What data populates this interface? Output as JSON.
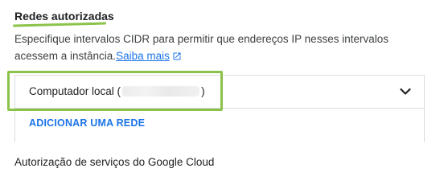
{
  "authorized_networks": {
    "title": "Redes autorizadas",
    "description": "Especifique intervalos CIDR para permitir que endereços IP nesses intervalos acessem a instância.",
    "learn_more": "Saiba mais",
    "networks": [
      {
        "label_prefix": "Computador local (",
        "label_suffix": ")"
      }
    ],
    "add_button": "ADICIONAR UMA REDE"
  },
  "next_section": {
    "title": "Autorização de serviços do Google Cloud"
  },
  "colors": {
    "accent_blue": "#1a73e8",
    "highlight_green": "#8bc34a",
    "border": "#dadce0"
  },
  "icons": {
    "learn_more": "external-link-icon",
    "expand": "chevron-down-icon"
  }
}
